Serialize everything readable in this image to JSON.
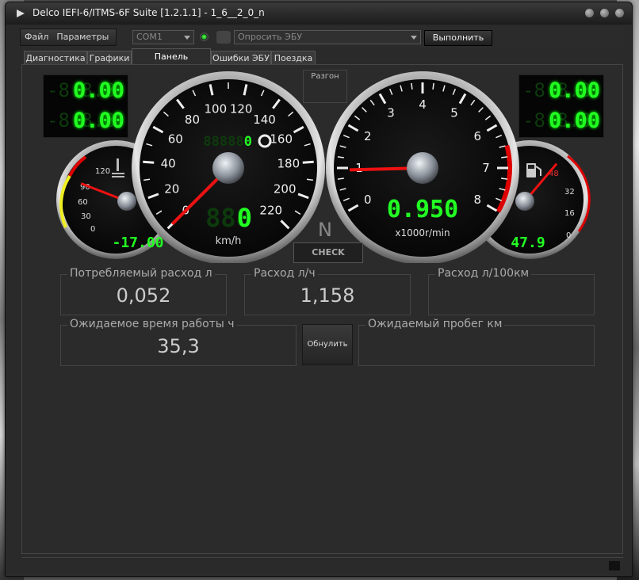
{
  "window": {
    "title": "Delco IEFI-6/ITMS-6F Suite [1.2.1.1] - 1_6__2_0_n"
  },
  "menu": {
    "file": "Файл",
    "params": "Параметры"
  },
  "toolbar": {
    "port": "COM1",
    "ecu_query": "Опросить ЭБУ",
    "execute": "Выполнить"
  },
  "tabs": [
    {
      "label": "Диагностика"
    },
    {
      "label": "Графики"
    },
    {
      "label": "Панель приборов"
    },
    {
      "label": "Ошибки ЭБУ"
    },
    {
      "label": "Поездка"
    }
  ],
  "lcd_left": {
    "top": "0.00",
    "bottom": "0.00"
  },
  "lcd_right": {
    "top": "0.00",
    "bottom": "0.00"
  },
  "razgon": "Разгон",
  "gear": "N",
  "check": "CHECK",
  "speedometer": {
    "ticks": [
      "0",
      "20",
      "40",
      "60",
      "80",
      "100",
      "120",
      "140",
      "160",
      "180",
      "200",
      "220"
    ],
    "unit": "km/h",
    "speed": "0",
    "odometer": "0",
    "speed_value": 0
  },
  "tachometer": {
    "ticks": [
      "0",
      "1",
      "2",
      "3",
      "4",
      "5",
      "6",
      "7",
      "8"
    ],
    "unit": "x1000r/min",
    "rpm": "0.950",
    "rpm_value": 0.95
  },
  "temp_gauge": {
    "ticks": [
      "120",
      "90",
      "60",
      "30",
      "0"
    ],
    "value": "-17.00",
    "value_num": 90
  },
  "fuel_gauge": {
    "ticks": [
      "48",
      "32",
      "16",
      "0"
    ],
    "value": "47.9",
    "value_num": 47.9
  },
  "fields": {
    "consumed_label": "Потребляемый расход л",
    "consumed_value": "0,052",
    "rate_label": "Расход л/ч",
    "rate_value": "1,158",
    "per100_label": "Расход л/100км",
    "per100_value": "",
    "time_label": "Ожидаемое время работы ч",
    "time_value": "35,3",
    "reset": "Обнулить",
    "range_label": "Ожидаемый пробег км",
    "range_value": ""
  },
  "colors": {
    "lcd_green": "#22ff22",
    "needle_red": "#ee1111",
    "redline": "#dd0000",
    "cold_yellow": "#eeee22"
  }
}
